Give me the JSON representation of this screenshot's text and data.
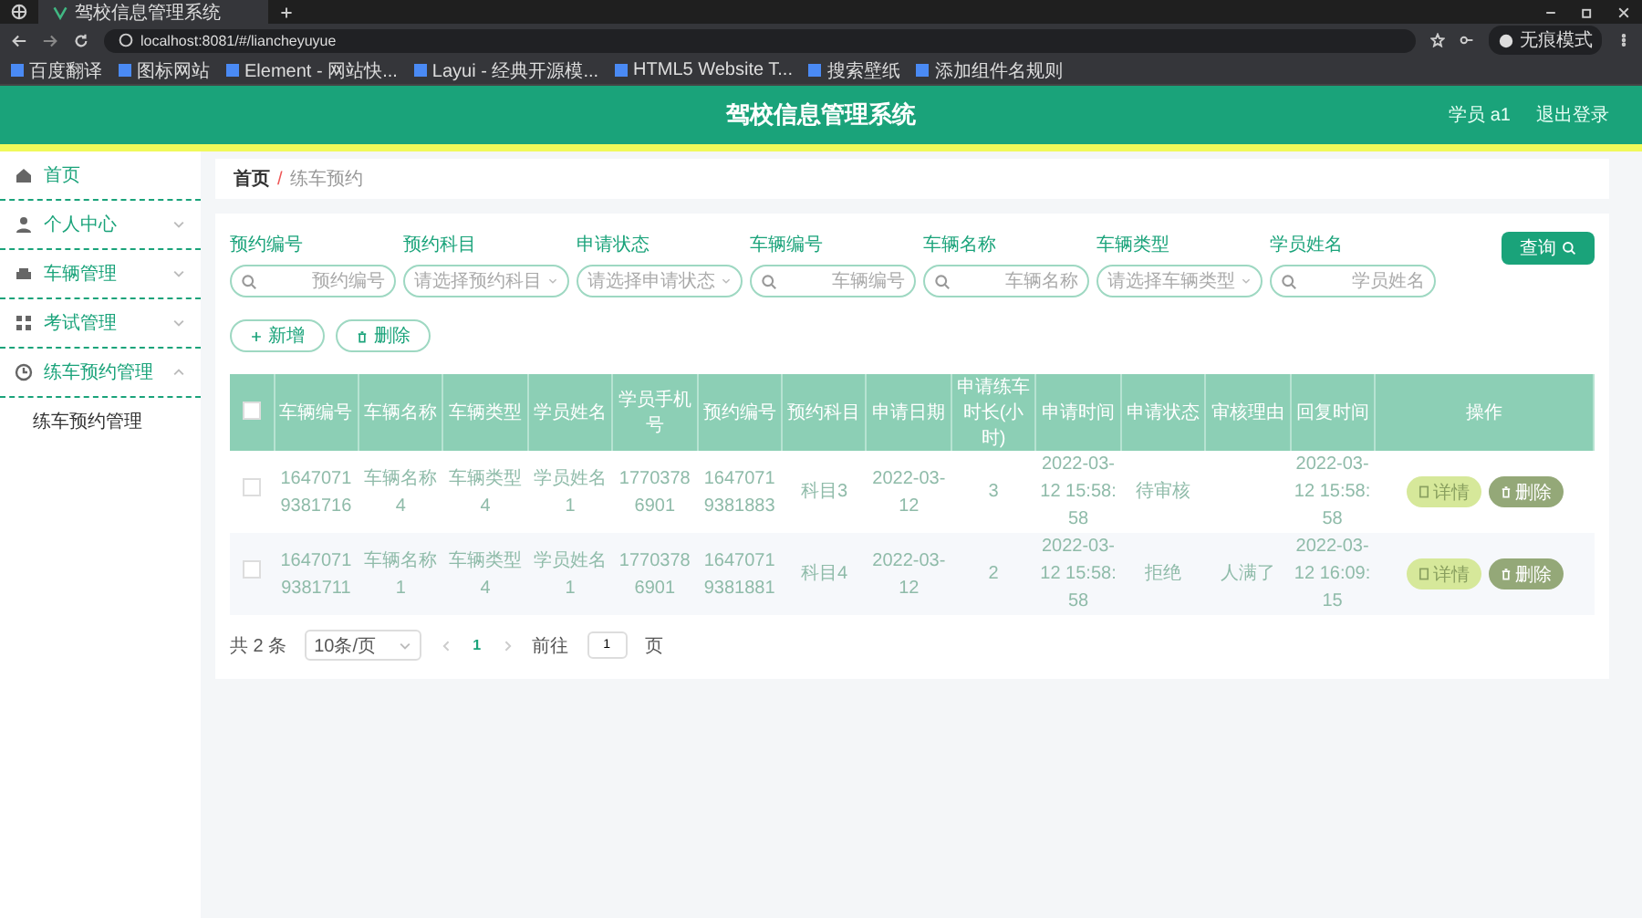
{
  "browser": {
    "tab_title": "驾校信息管理系统",
    "url": "localhost:8081/#/lianchеyuyue",
    "profile": "无痕模式",
    "bookmarks": [
      "百度翻译",
      "图标网站",
      "Element - 网站快...",
      "Layui - 经典开源模...",
      "HTML5 Website T...",
      "搜索壁纸",
      "添加组件名规则"
    ]
  },
  "header": {
    "title": "驾校信息管理系统",
    "user": "学员 a1",
    "logout": "退出登录"
  },
  "sidebar": {
    "items": [
      {
        "label": "首页"
      },
      {
        "label": "个人中心",
        "expanded": false
      },
      {
        "label": "车辆管理",
        "expanded": false
      },
      {
        "label": "考试管理",
        "expanded": false
      },
      {
        "label": "练车预约管理",
        "expanded": true,
        "children": [
          {
            "label": "练车预约管理"
          }
        ]
      }
    ]
  },
  "breadcrumb": {
    "items": [
      "首页",
      "练车预约"
    ],
    "separator": "/"
  },
  "filters": [
    {
      "kind": "search",
      "label": "预约编号",
      "placeholder": "预约编号"
    },
    {
      "kind": "select",
      "label": "预约科目",
      "placeholder": "请选择预约科目"
    },
    {
      "kind": "select",
      "label": "申请状态",
      "placeholder": "请选择申请状态"
    },
    {
      "kind": "search",
      "label": "车辆编号",
      "placeholder": "车辆编号"
    },
    {
      "kind": "search",
      "label": "车辆名称",
      "placeholder": "车辆名称"
    },
    {
      "kind": "select",
      "label": "车辆类型",
      "placeholder": "请选择车辆类型"
    },
    {
      "kind": "search",
      "label": "学员姓名",
      "placeholder": "学员姓名"
    }
  ],
  "query_button": "查询",
  "actions": [
    {
      "kind": "add",
      "label": "新增"
    },
    {
      "kind": "delete",
      "label": "删除"
    }
  ],
  "table": {
    "select_all_checked": false,
    "columns": [
      "车辆编号",
      "车辆名称",
      "车辆类型",
      "学员姓名",
      "学员手机号",
      "预约编号",
      "预约科目",
      "申请日期",
      "申请练车时长(小时)",
      "申请时间",
      "申请状态",
      "审核理由",
      "回复时间",
      "操作"
    ],
    "rows": [
      {
        "checked": false,
        "cells": [
          "16470719381716",
          "车辆名称4",
          "车辆类型4",
          "学员姓名1",
          "17703786901",
          "16470719381883",
          "科目3",
          "2022-03-12",
          "3",
          "2022-03-12 15:58:58",
          "待审核",
          "",
          "2022-03-12 15:58:58"
        ],
        "buttons": [
          "详情",
          "删除"
        ]
      },
      {
        "checked": false,
        "cells": [
          "16470719381711",
          "车辆名称1",
          "车辆类型4",
          "学员姓名1",
          "17703786901",
          "16470719381881",
          "科目4",
          "2022-03-12",
          "2",
          "2022-03-12 15:58:58",
          "拒绝",
          "人满了",
          "2022-03-12 16:09:15"
        ],
        "buttons": [
          "详情",
          "删除"
        ]
      }
    ]
  },
  "pagination": {
    "total": "共 2 条",
    "page_size": "10条/页",
    "pages": [
      {
        "label": "1",
        "selected": true
      }
    ],
    "goto_label": "前往",
    "goto_value": "1",
    "goto_suffix": "页"
  }
}
